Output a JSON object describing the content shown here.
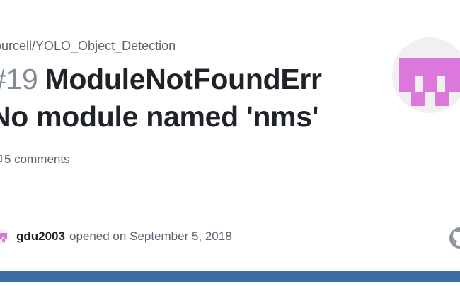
{
  "repo": {
    "path": "ourcell/YOLO_Object_Detection"
  },
  "issue": {
    "number": "#19",
    "title_line1": "ModuleNotFoundErr",
    "title_line2": "No module named 'nms'",
    "comments": "5 comments"
  },
  "opened": {
    "author": "gdu2003",
    "text": "opened on September 5, 2018"
  },
  "icons": {
    "comment": "comment-icon",
    "avatar": "identicon-avatar",
    "github": "github-mark-icon"
  },
  "colors": {
    "identicon": "#dc78dc",
    "bottom_bar": "#3a6ea5",
    "github_mark": "#8c959f"
  }
}
